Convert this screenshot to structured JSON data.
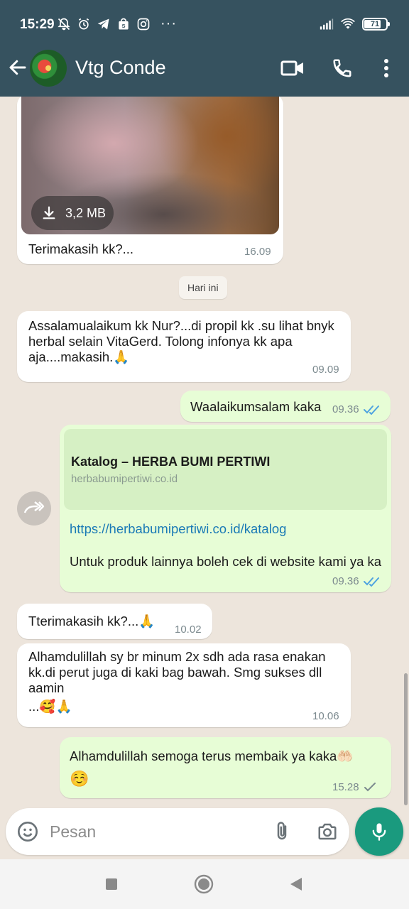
{
  "status_bar": {
    "time": "15:29",
    "dots": "···",
    "battery": "71",
    "battery_level": 0.71
  },
  "header": {
    "contact_name": "Vtg Conde",
    "icons": {
      "back": "arrow-back-icon",
      "video": "video-call-icon",
      "voice": "voice-call-icon",
      "menu": "more-vert-icon"
    }
  },
  "messages": [
    {
      "direction": "in",
      "kind": "media",
      "size_label": "3,2 MB",
      "caption": "Terimakasih kk?...",
      "time": "16.09"
    },
    {
      "kind": "day",
      "label": "Hari ini"
    },
    {
      "direction": "in",
      "text": "Assalamualaikum kk Nur?...di propil kk .su lihat bnyk herbal selain VitaGerd. Tolong infonya kk apa aja....makasih.",
      "emoji": "🙏",
      "time": "09.09"
    },
    {
      "direction": "out",
      "text": "Waalaikumsalam kaka",
      "time": "09.36",
      "ticks": "read"
    },
    {
      "direction": "out",
      "kind": "link",
      "preview_title": "Katalog – HERBA BUMI PERTIWI",
      "preview_domain": "herbabumipertiwi.co.id",
      "url": "https://herbabumipertiwi.co.id/katalog",
      "text": "Untuk produk lainnya boleh cek di website kami ya ka",
      "time": "09.36",
      "ticks": "read"
    },
    {
      "direction": "in",
      "text": "Tterimakasih kk?...",
      "emoji": "🙏",
      "time": "10.02"
    },
    {
      "direction": "in",
      "text": "Alhamdulillah sy br minum 2x sdh ada rasa enakan kk.di perut juga di kaki bag bawah. Smg sukses dll aamin",
      "emoji_line": "...🥰🙏",
      "time": "10.06"
    },
    {
      "direction": "out",
      "text": "Alhamdulillah semoga terus membaik ya kaka",
      "emoji": "🤲🏻",
      "emoji_line": "☺️",
      "time": "15.28",
      "ticks": "sent"
    }
  ],
  "composer": {
    "placeholder": "Pesan",
    "icons": [
      "emoji-icon",
      "attach-icon",
      "camera-icon",
      "mic-icon"
    ]
  },
  "navbar": {
    "icons": [
      "recents-icon",
      "home-icon",
      "back-triangle-icon"
    ]
  },
  "colors": {
    "header": "#36525f",
    "chat_bg": "#ede5dc",
    "outgoing": "#e7fdd6",
    "incoming": "#ffffff",
    "mic": "#1a9a7e",
    "link": "#1a7ab6",
    "read_tick": "#4fa3e0"
  }
}
